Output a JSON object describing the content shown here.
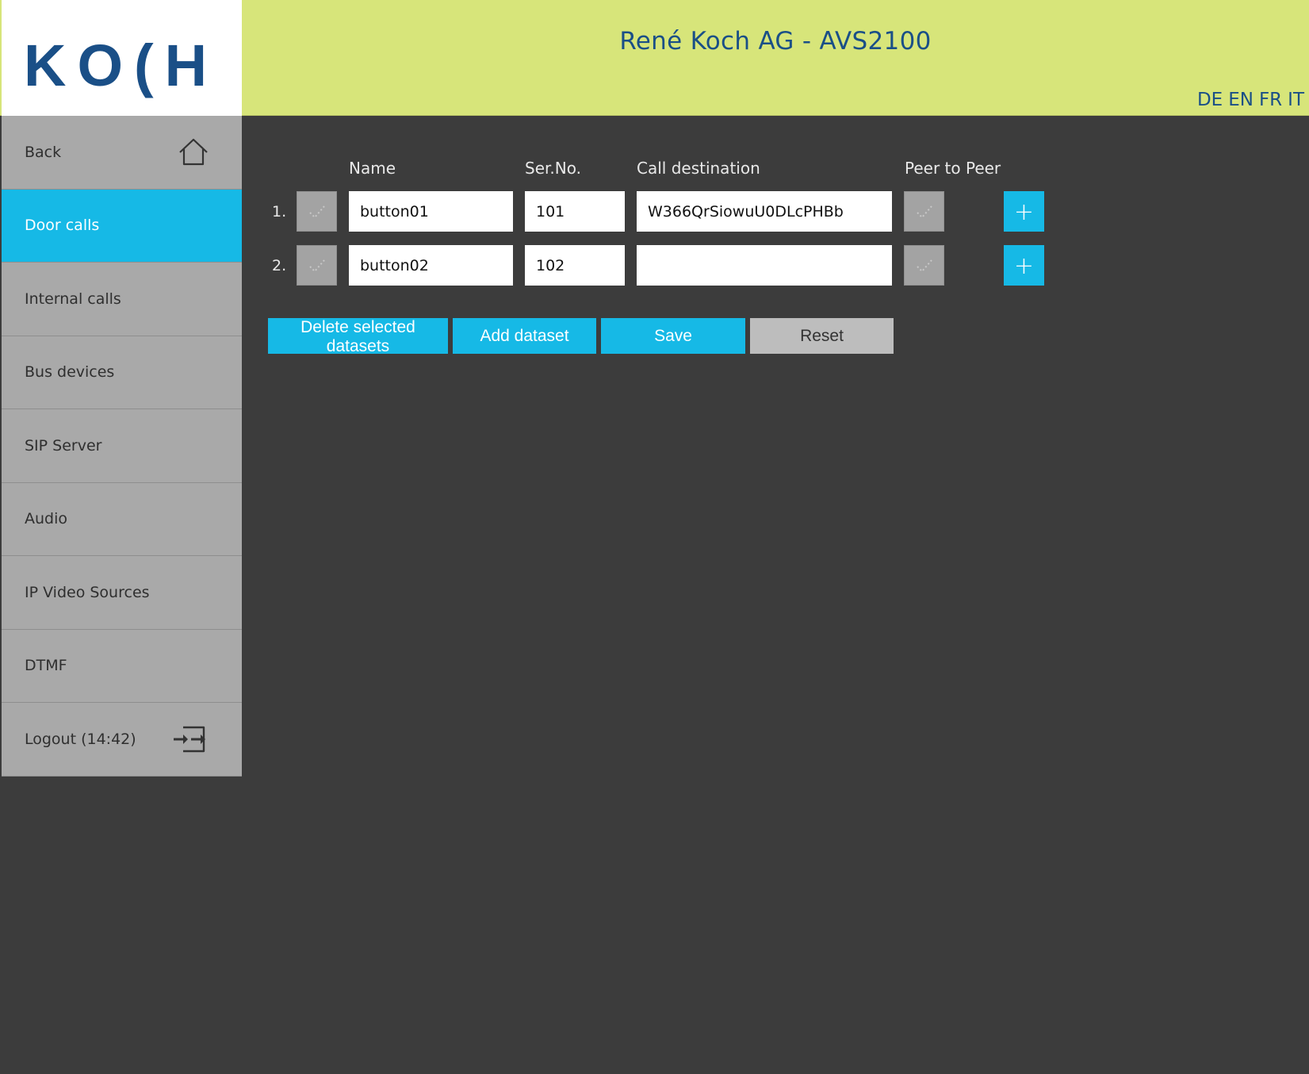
{
  "header": {
    "logo_text": "KO(H",
    "title": "René Koch AG - AVS2100",
    "languages": [
      "DE",
      "EN",
      "FR",
      "IT"
    ]
  },
  "sidebar": {
    "items": [
      {
        "label": "Back",
        "icon": "home-icon"
      },
      {
        "label": "Door calls"
      },
      {
        "label": "Internal calls"
      },
      {
        "label": "Bus devices"
      },
      {
        "label": "SIP Server"
      },
      {
        "label": "Audio"
      },
      {
        "label": "IP Video Sources"
      },
      {
        "label": "DTMF"
      },
      {
        "label": "Logout (14:42)",
        "icon": "logout-icon"
      }
    ],
    "active_index": 1
  },
  "table": {
    "headers": {
      "name": "Name",
      "serno": "Ser.No.",
      "destination": "Call destination",
      "p2p": "Peer to Peer"
    },
    "rows": [
      {
        "num": "1.",
        "name": "button01",
        "serno": "101",
        "destination": "W366QrSiowuU0DLcPHBb"
      },
      {
        "num": "2.",
        "name": "button02",
        "serno": "102",
        "destination": ""
      }
    ],
    "add_symbol": "+"
  },
  "actions": {
    "delete_label": "Delete selected datasets",
    "add_label": "Add dataset",
    "save_label": "Save",
    "reset_label": "Reset"
  },
  "colors": {
    "header_bg": "#d7e57a",
    "brand_blue": "#1a4f87",
    "accent": "#16b9e6",
    "nav_bg": "#a9a9a9",
    "content_bg": "#3c3c3c"
  }
}
